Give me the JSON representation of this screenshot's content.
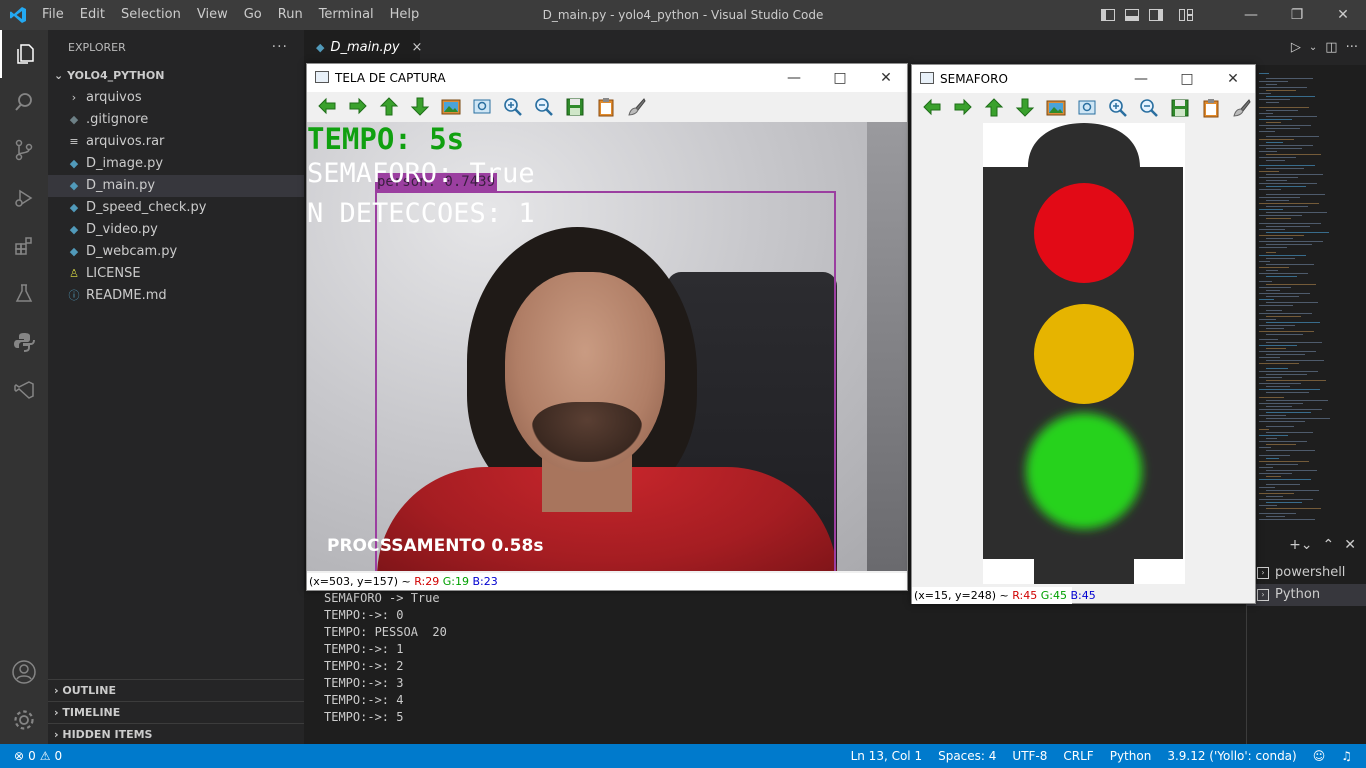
{
  "window": {
    "title": "D_main.py - yolo4_python - Visual Studio Code",
    "menu": [
      "File",
      "Edit",
      "Selection",
      "View",
      "Go",
      "Run",
      "Terminal",
      "Help"
    ]
  },
  "explorer": {
    "header": "EXPLORER",
    "folder": "YOLO4_PYTHON",
    "items": [
      {
        "label": "arquivos",
        "icon": "chevron-right-icon",
        "glyph": "›"
      },
      {
        "label": ".gitignore",
        "icon": "diamond-icon",
        "glyph": "◆"
      },
      {
        "label": "arquivos.rar",
        "icon": "lines-icon",
        "glyph": "≡"
      },
      {
        "label": "D_image.py",
        "icon": "python-icon",
        "glyph": "◆"
      },
      {
        "label": "D_main.py",
        "icon": "python-icon",
        "glyph": "◆"
      },
      {
        "label": "D_speed_check.py",
        "icon": "python-icon",
        "glyph": "◆"
      },
      {
        "label": "D_video.py",
        "icon": "python-icon",
        "glyph": "◆"
      },
      {
        "label": "D_webcam.py",
        "icon": "python-icon",
        "glyph": "◆"
      },
      {
        "label": "LICENSE",
        "icon": "license-icon",
        "glyph": "♙"
      },
      {
        "label": "README.md",
        "icon": "info-icon",
        "glyph": "ⓘ"
      }
    ],
    "sections": [
      "OUTLINE",
      "TIMELINE",
      "HIDDEN ITEMS"
    ]
  },
  "editor": {
    "tab_label": "D_main.py",
    "tab_close": "×"
  },
  "terminal": {
    "lines": [
      "SEMAFORO -> True",
      "TEMPO:->: 0",
      "TEMPO: PESSOA  20",
      "TEMPO:->: 1",
      "TEMPO:->: 2",
      "TEMPO:->: 3",
      "TEMPO:->: 4",
      "TEMPO:->: 5"
    ],
    "shells": [
      "powershell",
      "Python"
    ]
  },
  "statusbar": {
    "errors": "0",
    "warnings": "0",
    "position": "Ln 13, Col 1",
    "spaces": "Spaces: 4",
    "encoding": "UTF-8",
    "eol": "CRLF",
    "language": "Python",
    "interpreter": "3.9.12 ('Yollo': conda)"
  },
  "capture_window": {
    "title": "TELA DE CAPTURA",
    "tempo": "TEMPO: 5s",
    "semaforo": "SEMAFORO: True",
    "deteccoes": "N DETECCOES: 1",
    "detection_label": "person: 0.7439",
    "processamento": "PROCSSAMENTO 0.58s",
    "status_coords": "(x=503, y=157) ~ ",
    "status_r": "R:29",
    "status_g": "G:19",
    "status_b": "B:23"
  },
  "semaforo_window": {
    "title": "SEMAFORO",
    "status_coords": "(x=15, y=248) ~ ",
    "status_r": "R:45",
    "status_g": "G:45",
    "status_b": "B:45",
    "lights": {
      "red": "#e20a16",
      "yellow": "#e6b400",
      "green": "#28d21e"
    }
  },
  "toolbar_icons": [
    "arrow-left-icon",
    "arrow-right-icon",
    "arrow-up-icon",
    "arrow-down-icon",
    "image-icon",
    "zoom-fit-icon",
    "zoom-in-icon",
    "zoom-out-icon",
    "save-icon",
    "clipboard-icon",
    "brush-icon"
  ],
  "colors": {
    "accent": "#007acc",
    "bbox": "#9b3fa0",
    "tempo_text": "#10a010"
  }
}
